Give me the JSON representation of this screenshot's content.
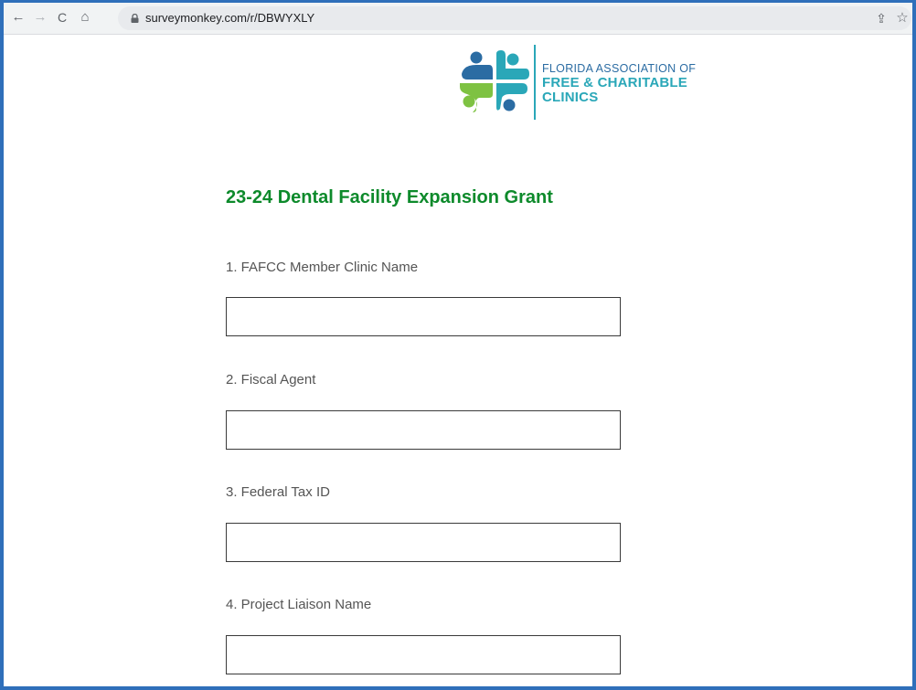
{
  "browser": {
    "url": "surveymonkey.com/r/DBWYXLY",
    "back_icon": "←",
    "forward_icon": "→",
    "reload_icon": "C",
    "home_icon": "⌂",
    "share_icon": "⇪",
    "bookmark_icon": "☆"
  },
  "logo": {
    "line1": "FLORIDA ASSOCIATION OF",
    "line2": "FREE & CHARITABLE",
    "line3": "CLINICS",
    "colors": {
      "blue": "#2b6ca3",
      "teal": "#2aa7b8",
      "green": "#7ec242"
    }
  },
  "survey": {
    "title": "23-24 Dental Facility Expansion Grant",
    "title_color": "#0d8a2b",
    "questions": [
      {
        "label": "1. FAFCC Member Clinic Name",
        "value": ""
      },
      {
        "label": "2. Fiscal Agent",
        "value": ""
      },
      {
        "label": "3. Federal Tax ID",
        "value": ""
      },
      {
        "label": "4. Project Liaison Name",
        "value": ""
      }
    ]
  }
}
